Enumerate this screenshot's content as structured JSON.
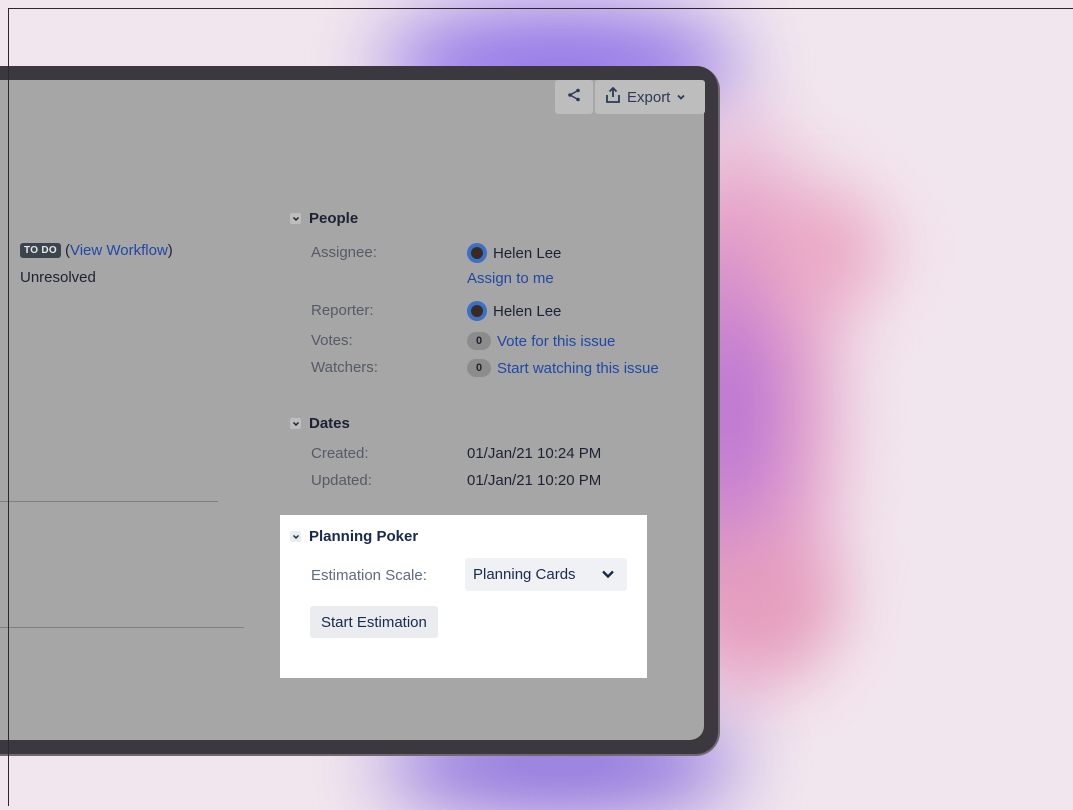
{
  "toolbar": {
    "share_icon": "share-icon",
    "export_label": "Export"
  },
  "issue": {
    "status_lozenge": "TO DO",
    "workflow_link": "View Workflow",
    "resolution": "Unresolved"
  },
  "people": {
    "title": "People",
    "assignee_label": "Assignee:",
    "assignee_name": "Helen Lee",
    "assign_link": "Assign to me",
    "reporter_label": "Reporter:",
    "reporter_name": "Helen Lee",
    "votes_label": "Votes:",
    "votes_count": "0",
    "votes_link": "Vote for this issue",
    "watchers_label": "Watchers:",
    "watchers_count": "0",
    "watchers_link": "Start watching this issue"
  },
  "dates": {
    "title": "Dates",
    "created_label": "Created:",
    "created_value": "01/Jan/21 10:24 PM",
    "updated_label": "Updated:",
    "updated_value": "01/Jan/21 10:20 PM"
  },
  "planning_poker": {
    "title": "Planning Poker",
    "scale_label": "Estimation Scale:",
    "scale_value": "Planning Cards",
    "start_button": "Start Estimation"
  }
}
